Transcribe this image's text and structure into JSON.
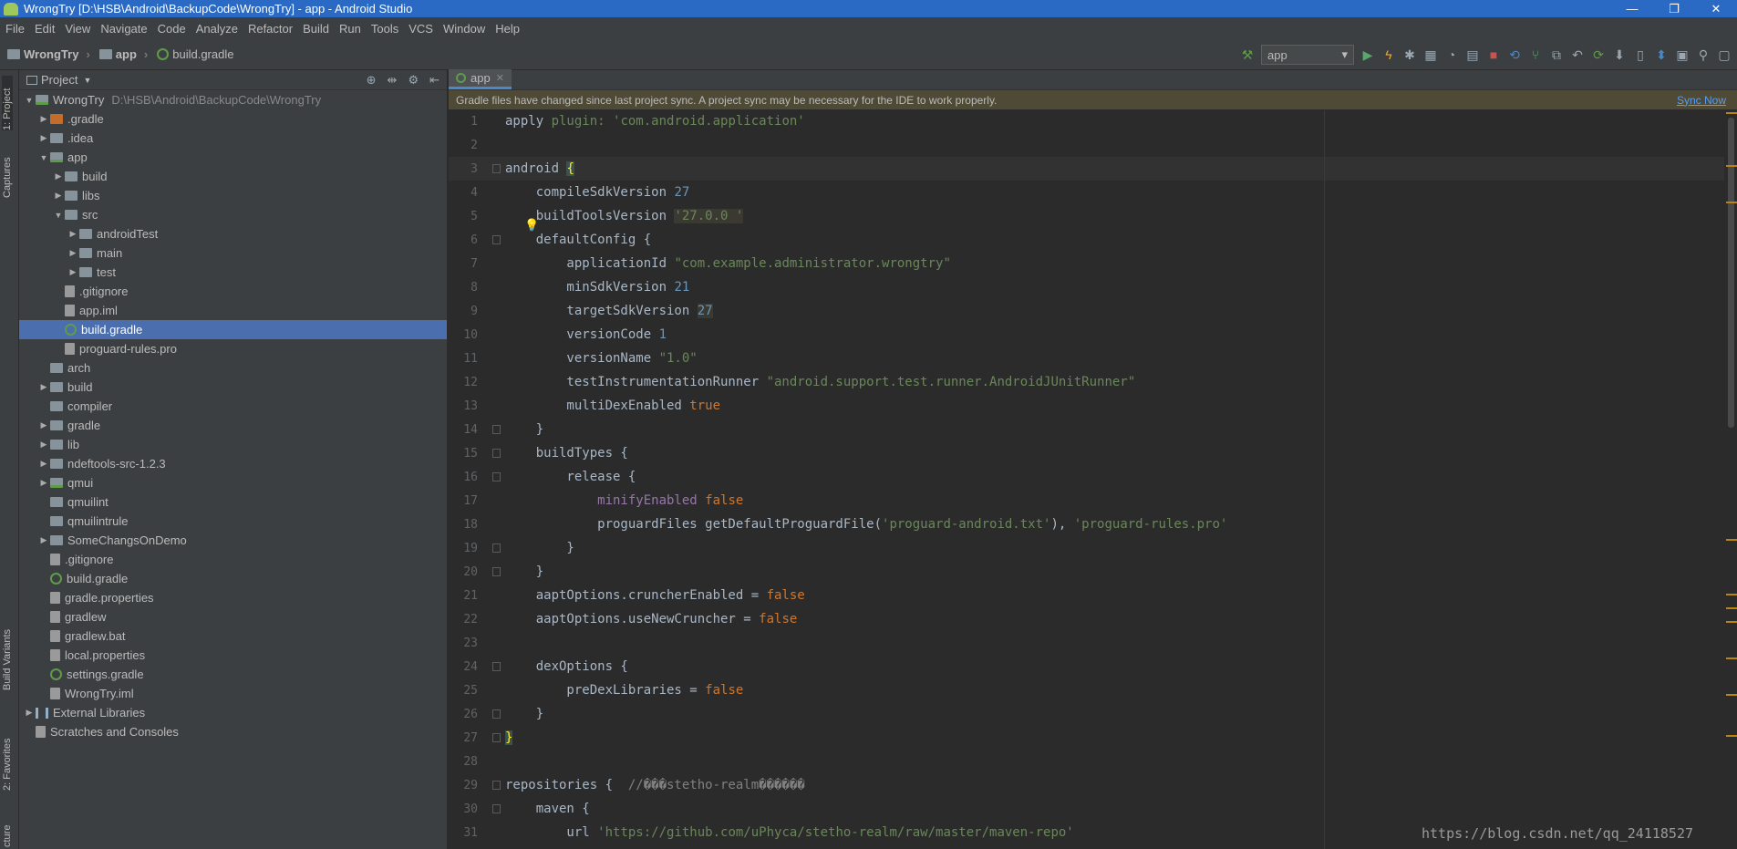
{
  "window": {
    "title": "WrongTry [D:\\HSB\\Android\\BackupCode\\WrongTry] - app - Android Studio",
    "controls": [
      "—",
      "❐",
      "✕"
    ]
  },
  "menu": [
    "File",
    "Edit",
    "View",
    "Navigate",
    "Code",
    "Analyze",
    "Refactor",
    "Build",
    "Run",
    "Tools",
    "VCS",
    "Window",
    "Help"
  ],
  "breadcrumb": {
    "project": "WrongTry",
    "module": "app",
    "file": "build.gradle"
  },
  "toolbar": {
    "run_config": "app"
  },
  "side_tabs": {
    "project": "1: Project",
    "captures": "Captures",
    "build_variants": "Build Variants",
    "favorites": "2: Favorites",
    "structure": "cture"
  },
  "project_panel": {
    "title": "Project",
    "root_path": "D:\\HSB\\Android\\BackupCode\\WrongTry",
    "tree": [
      {
        "label": "WrongTry",
        "depth": 0,
        "arrow": "▼",
        "icon": "folder-module"
      },
      {
        "label": ".gradle",
        "depth": 1,
        "arrow": "▶",
        "icon": "folder-orange"
      },
      {
        "label": ".idea",
        "depth": 1,
        "arrow": "▶",
        "icon": "folder"
      },
      {
        "label": "app",
        "depth": 1,
        "arrow": "▼",
        "icon": "folder-module"
      },
      {
        "label": "build",
        "depth": 2,
        "arrow": "▶",
        "icon": "folder"
      },
      {
        "label": "libs",
        "depth": 2,
        "arrow": "▶",
        "icon": "folder"
      },
      {
        "label": "src",
        "depth": 2,
        "arrow": "▼",
        "icon": "folder"
      },
      {
        "label": "androidTest",
        "depth": 3,
        "arrow": "▶",
        "icon": "folder"
      },
      {
        "label": "main",
        "depth": 3,
        "arrow": "▶",
        "icon": "folder"
      },
      {
        "label": "test",
        "depth": 3,
        "arrow": "▶",
        "icon": "folder"
      },
      {
        "label": ".gitignore",
        "depth": 2,
        "arrow": "",
        "icon": "file"
      },
      {
        "label": "app.iml",
        "depth": 2,
        "arrow": "",
        "icon": "file"
      },
      {
        "label": "build.gradle",
        "depth": 2,
        "arrow": "",
        "icon": "gradle",
        "selected": true
      },
      {
        "label": "proguard-rules.pro",
        "depth": 2,
        "arrow": "",
        "icon": "file"
      },
      {
        "label": "arch",
        "depth": 1,
        "arrow": "",
        "icon": "folder"
      },
      {
        "label": "build",
        "depth": 1,
        "arrow": "▶",
        "icon": "folder"
      },
      {
        "label": "compiler",
        "depth": 1,
        "arrow": "",
        "icon": "folder"
      },
      {
        "label": "gradle",
        "depth": 1,
        "arrow": "▶",
        "icon": "folder"
      },
      {
        "label": "lib",
        "depth": 1,
        "arrow": "▶",
        "icon": "folder"
      },
      {
        "label": "ndeftools-src-1.2.3",
        "depth": 1,
        "arrow": "▶",
        "icon": "folder"
      },
      {
        "label": "qmui",
        "depth": 1,
        "arrow": "▶",
        "icon": "folder-module"
      },
      {
        "label": "qmuilint",
        "depth": 1,
        "arrow": "",
        "icon": "folder"
      },
      {
        "label": "qmuilintrule",
        "depth": 1,
        "arrow": "",
        "icon": "folder"
      },
      {
        "label": "SomeChangsOnDemo",
        "depth": 1,
        "arrow": "▶",
        "icon": "folder"
      },
      {
        "label": ".gitignore",
        "depth": 1,
        "arrow": "",
        "icon": "file"
      },
      {
        "label": "build.gradle",
        "depth": 1,
        "arrow": "",
        "icon": "gradle"
      },
      {
        "label": "gradle.properties",
        "depth": 1,
        "arrow": "",
        "icon": "file"
      },
      {
        "label": "gradlew",
        "depth": 1,
        "arrow": "",
        "icon": "file"
      },
      {
        "label": "gradlew.bat",
        "depth": 1,
        "arrow": "",
        "icon": "file"
      },
      {
        "label": "local.properties",
        "depth": 1,
        "arrow": "",
        "icon": "file"
      },
      {
        "label": "settings.gradle",
        "depth": 1,
        "arrow": "",
        "icon": "gradle"
      },
      {
        "label": "WrongTry.iml",
        "depth": 1,
        "arrow": "",
        "icon": "file"
      },
      {
        "label": "External Libraries",
        "depth": 0,
        "arrow": "▶",
        "icon": "library"
      },
      {
        "label": "Scratches and Consoles",
        "depth": 0,
        "arrow": "",
        "icon": "file"
      }
    ]
  },
  "editor": {
    "tab": "app",
    "notification": "Gradle files have changed since last project sync. A project sync may be necessary for the IDE to work properly.",
    "sync_link": "Sync Now",
    "lines": [
      {
        "n": "1",
        "fold": false,
        "parts": [
          [
            "t",
            "apply "
          ],
          [
            "str",
            "plugin: "
          ],
          [
            "str",
            "'com.android.application'"
          ]
        ]
      },
      {
        "n": "2",
        "fold": false,
        "parts": []
      },
      {
        "n": "3",
        "fold": true,
        "current": true,
        "parts": [
          [
            "t",
            "android "
          ],
          [
            "brace",
            "{"
          ]
        ]
      },
      {
        "n": "4",
        "fold": false,
        "parts": [
          [
            "t",
            "    compileSdkVersion "
          ],
          [
            "num",
            "27"
          ]
        ]
      },
      {
        "n": "5",
        "fold": false,
        "parts": [
          [
            "t",
            "    buildToolsVersion "
          ],
          [
            "hlstr",
            "'27.0.0 '"
          ]
        ]
      },
      {
        "n": "6",
        "fold": true,
        "parts": [
          [
            "t",
            "    defaultConfig {"
          ]
        ]
      },
      {
        "n": "7",
        "fold": false,
        "parts": [
          [
            "t",
            "        applicationId "
          ],
          [
            "str",
            "\"com.example.administrator.wrongtry\""
          ]
        ]
      },
      {
        "n": "8",
        "fold": false,
        "parts": [
          [
            "t",
            "        minSdkVersion "
          ],
          [
            "num",
            "21"
          ]
        ]
      },
      {
        "n": "9",
        "fold": false,
        "parts": [
          [
            "t",
            "        targetSdkVersion "
          ],
          [
            "hlnum",
            "27"
          ]
        ]
      },
      {
        "n": "10",
        "fold": false,
        "parts": [
          [
            "t",
            "        versionCode "
          ],
          [
            "num",
            "1"
          ]
        ]
      },
      {
        "n": "11",
        "fold": false,
        "parts": [
          [
            "t",
            "        versionName "
          ],
          [
            "str",
            "\"1.0\""
          ]
        ]
      },
      {
        "n": "12",
        "fold": false,
        "parts": [
          [
            "t",
            "        testInstrumentationRunner "
          ],
          [
            "str",
            "\"android.support.test.runner.AndroidJUnitRunner\""
          ]
        ]
      },
      {
        "n": "13",
        "fold": false,
        "parts": [
          [
            "t",
            "        multiDexEnabled "
          ],
          [
            "kw",
            "true"
          ]
        ]
      },
      {
        "n": "14",
        "fold": true,
        "parts": [
          [
            "t",
            "    }"
          ]
        ]
      },
      {
        "n": "15",
        "fold": true,
        "parts": [
          [
            "t",
            "    buildTypes {"
          ]
        ]
      },
      {
        "n": "16",
        "fold": true,
        "parts": [
          [
            "t",
            "        release {"
          ]
        ]
      },
      {
        "n": "17",
        "fold": false,
        "parts": [
          [
            "purp",
            "            minifyEnabled "
          ],
          [
            "kw",
            "false"
          ]
        ]
      },
      {
        "n": "18",
        "fold": false,
        "parts": [
          [
            "t",
            "            proguardFiles getDefaultProguardFile("
          ],
          [
            "str",
            "'proguard-android.txt'"
          ],
          [
            "t",
            "), "
          ],
          [
            "str",
            "'proguard-rules.pro'"
          ]
        ]
      },
      {
        "n": "19",
        "fold": true,
        "parts": [
          [
            "t",
            "        }"
          ]
        ]
      },
      {
        "n": "20",
        "fold": true,
        "parts": [
          [
            "t",
            "    }"
          ]
        ]
      },
      {
        "n": "21",
        "fold": false,
        "parts": [
          [
            "t",
            "    aaptOptions.cruncherEnabled = "
          ],
          [
            "kw",
            "false"
          ]
        ]
      },
      {
        "n": "22",
        "fold": false,
        "parts": [
          [
            "t",
            "    aaptOptions.useNewCruncher = "
          ],
          [
            "kw",
            "false"
          ]
        ]
      },
      {
        "n": "23",
        "fold": false,
        "parts": []
      },
      {
        "n": "24",
        "fold": true,
        "parts": [
          [
            "t",
            "    dexOptions {"
          ]
        ]
      },
      {
        "n": "25",
        "fold": false,
        "parts": [
          [
            "t",
            "        preDexLibraries = "
          ],
          [
            "kw",
            "false"
          ]
        ]
      },
      {
        "n": "26",
        "fold": true,
        "parts": [
          [
            "t",
            "    }"
          ]
        ]
      },
      {
        "n": "27",
        "fold": true,
        "parts": [
          [
            "brace",
            "}"
          ]
        ]
      },
      {
        "n": "28",
        "fold": false,
        "parts": []
      },
      {
        "n": "29",
        "fold": true,
        "parts": [
          [
            "t",
            "repositories {  "
          ],
          [
            "cmt",
            "//���stetho-realm������ "
          ]
        ]
      },
      {
        "n": "30",
        "fold": true,
        "parts": [
          [
            "t",
            "    maven {"
          ]
        ]
      },
      {
        "n": "31",
        "fold": false,
        "parts": [
          [
            "t",
            "        url "
          ],
          [
            "str",
            "'https://github.com/uPhyca/stetho-realm/raw/master/maven-repo'"
          ]
        ]
      }
    ]
  },
  "watermark": "https://blog.csdn.net/qq_24118527"
}
